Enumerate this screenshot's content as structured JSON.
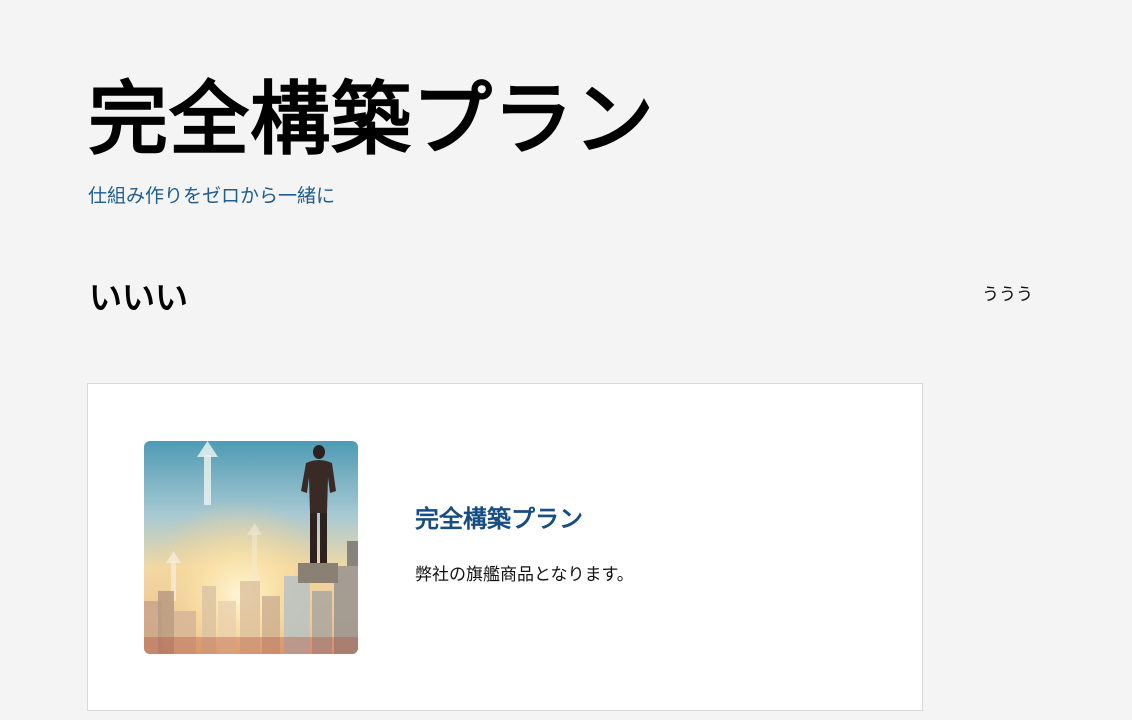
{
  "hero": {
    "title": "完全構築プラン",
    "subtitle": "仕組み作りをゼロから一緒に"
  },
  "section": {
    "heading": "いいい",
    "side_link": "ううう"
  },
  "plan_card": {
    "image_icon": "businessman-on-city-skyline-image",
    "title": "完全構築プラン",
    "description": "弊社の旗艦商品となります。"
  },
  "colors": {
    "background": "#f4f4f4",
    "subtitle": "#1f5e8e",
    "card_title": "#174d82",
    "card_border": "#d9d9d9"
  }
}
